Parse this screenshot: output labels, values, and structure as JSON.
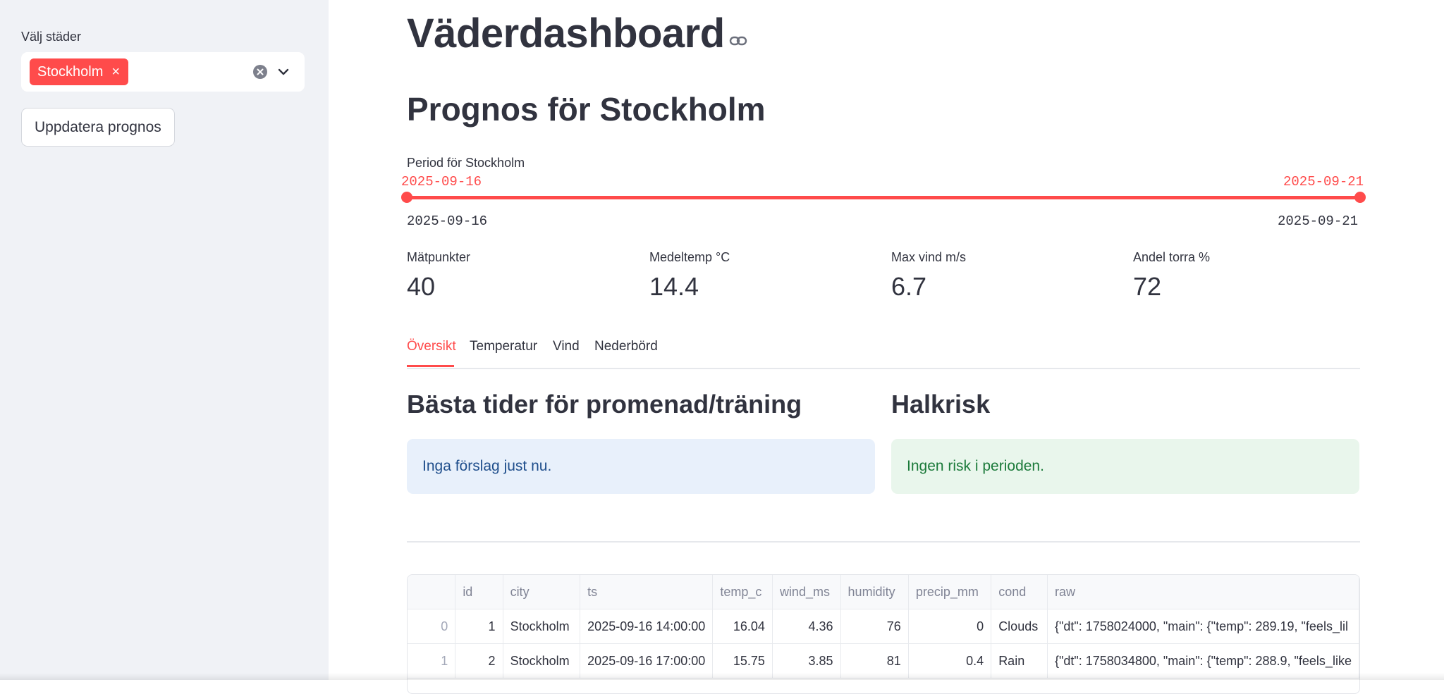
{
  "sidebar": {
    "select_label": "Välj städer",
    "selected_city": "Stockholm",
    "chip_remove": "×",
    "update_button": "Uppdatera prognos"
  },
  "header": {
    "title": "Väderdashboard"
  },
  "forecast": {
    "heading": "Prognos för Stockholm",
    "period_label": "Period för Stockholm",
    "range_start": "2025-09-16",
    "range_end": "2025-09-21",
    "min_date": "2025-09-16",
    "max_date": "2025-09-21"
  },
  "metrics": [
    {
      "label": "Mätpunkter",
      "value": "40"
    },
    {
      "label": "Medeltemp °C",
      "value": "14.4"
    },
    {
      "label": "Max vind m/s",
      "value": "6.7"
    },
    {
      "label": "Andel torra %",
      "value": "72"
    }
  ],
  "tabs": [
    {
      "label": "Översikt",
      "active": true
    },
    {
      "label": "Temperatur"
    },
    {
      "label": "Vind"
    },
    {
      "label": "Nederbörd"
    }
  ],
  "overview": {
    "best_times_heading": "Bästa tider för promenad/träning",
    "best_times_message": "Inga förslag just nu.",
    "slip_heading": "Halkrisk",
    "slip_message": "Ingen risk i perioden."
  },
  "table": {
    "columns": [
      "",
      "id",
      "city",
      "ts",
      "temp_c",
      "wind_ms",
      "humidity",
      "precip_mm",
      "cond",
      "raw"
    ],
    "rows": [
      [
        "0",
        "1",
        "Stockholm",
        "2025-09-16 14:00:00",
        "16.04",
        "4.36",
        "76",
        "0",
        "Clouds",
        "{\"dt\": 1758024000, \"main\": {\"temp\": 289.19, \"feels_lil"
      ],
      [
        "1",
        "2",
        "Stockholm",
        "2025-09-16 17:00:00",
        "15.75",
        "3.85",
        "81",
        "0.4",
        "Rain",
        "{\"dt\": 1758034800, \"main\": {\"temp\": 288.9, \"feels_like"
      ]
    ]
  },
  "colors": {
    "accent": "#ff4b4b",
    "sidebar_bg": "#f0f2f6",
    "info_bg": "#e8f0fb",
    "success_bg": "#e9f6ec"
  },
  "icons": {
    "link": "link-icon",
    "clear": "clear-icon",
    "dropdown": "chevron-down-icon"
  }
}
